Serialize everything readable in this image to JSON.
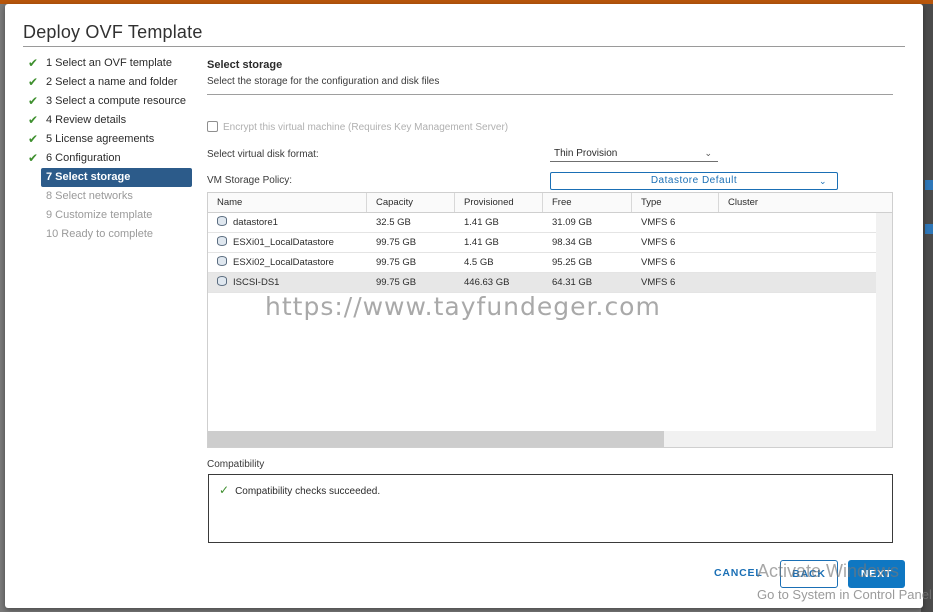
{
  "dialog": {
    "title": "Deploy OVF Template"
  },
  "steps": [
    {
      "label": "1 Select an OVF template",
      "state": "done"
    },
    {
      "label": "2 Select a name and folder",
      "state": "done"
    },
    {
      "label": "3 Select a compute resource",
      "state": "done"
    },
    {
      "label": "4 Review details",
      "state": "done"
    },
    {
      "label": "5 License agreements",
      "state": "done"
    },
    {
      "label": "6 Configuration",
      "state": "done"
    },
    {
      "label": "7 Select storage",
      "state": "active"
    },
    {
      "label": "8 Select networks",
      "state": "pending"
    },
    {
      "label": "9 Customize template",
      "state": "pending"
    },
    {
      "label": "10 Ready to complete",
      "state": "pending"
    }
  ],
  "content": {
    "title": "Select storage",
    "subtitle": "Select the storage for the configuration and disk files",
    "encrypt_label": "Encrypt this virtual machine (Requires Key Management Server)",
    "disk_format_label": "Select virtual disk format:",
    "disk_format_value": "Thin Provision",
    "policy_label": "VM Storage Policy:",
    "policy_value": "Datastore Default"
  },
  "table": {
    "columns": [
      "Name",
      "Capacity",
      "Provisioned",
      "Free",
      "Type",
      "Cluster"
    ],
    "rows": [
      {
        "name": "datastore1",
        "capacity": "32.5 GB",
        "provisioned": "1.41 GB",
        "free": "31.09 GB",
        "type": "VMFS 6",
        "cluster": ""
      },
      {
        "name": "ESXi01_LocalDatastore",
        "capacity": "99.75 GB",
        "provisioned": "1.41 GB",
        "free": "98.34 GB",
        "type": "VMFS 6",
        "cluster": ""
      },
      {
        "name": "ESXi02_LocalDatastore",
        "capacity": "99.75 GB",
        "provisioned": "4.5 GB",
        "free": "95.25 GB",
        "type": "VMFS 6",
        "cluster": ""
      },
      {
        "name": "ISCSI-DS1",
        "capacity": "99.75 GB",
        "provisioned": "446.63 GB",
        "free": "64.31 GB",
        "type": "VMFS 6",
        "cluster": "",
        "selected": true
      }
    ]
  },
  "watermark": "https://www.tayfundeger.com",
  "compatibility": {
    "label": "Compatibility",
    "message": "Compatibility checks succeeded."
  },
  "footer": {
    "cancel": "CANCEL",
    "back": "BACK",
    "next": "NEXT"
  },
  "os_overlay": {
    "line1": "Activate Windows",
    "line2": "Go to System in Control Panel"
  },
  "colors": {
    "accent": "#1a6fb5",
    "active_step": "#2c5b8a",
    "success": "#3e8f2e"
  }
}
